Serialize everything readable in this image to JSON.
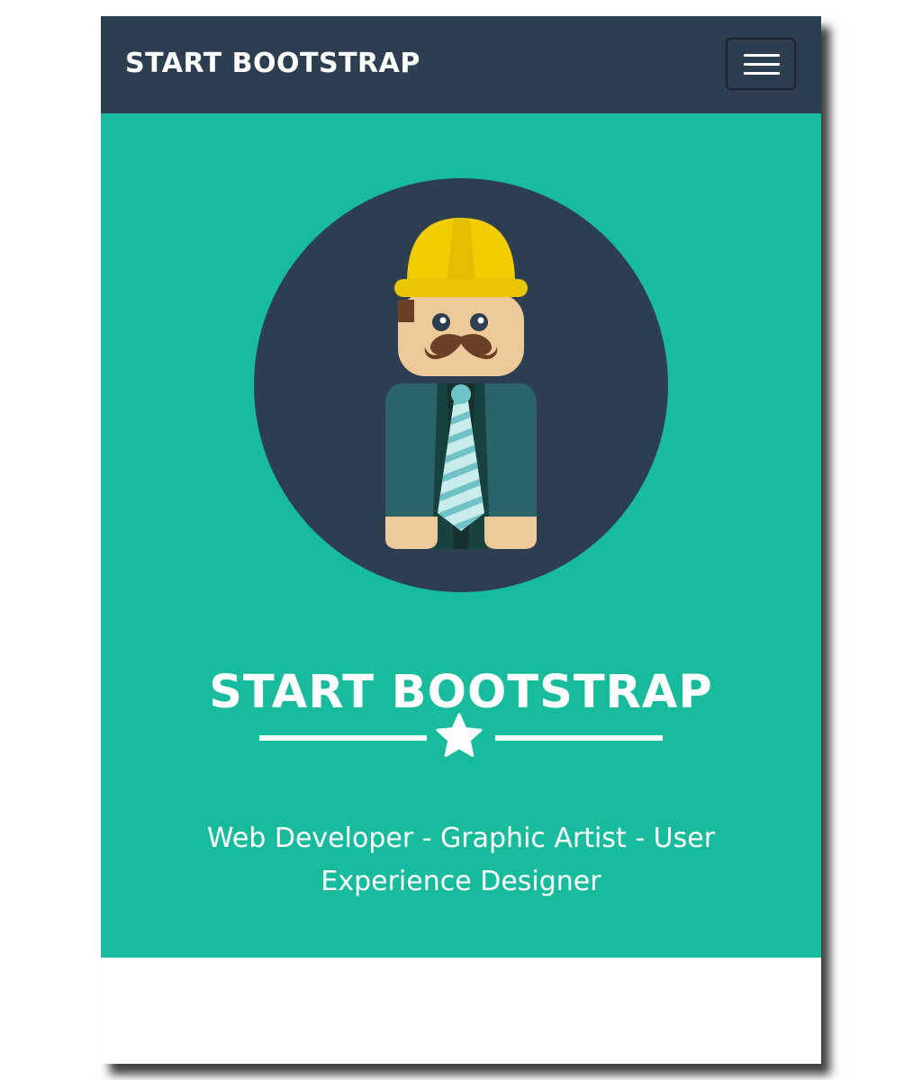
{
  "navbar": {
    "brand": "START BOOTSTRAP",
    "menu_icon": "hamburger-menu-icon"
  },
  "hero": {
    "avatar_icon": "construction-worker-avatar-icon",
    "title": "START BOOTSTRAP",
    "divider_icon": "star-icon",
    "tagline": "Web Developer - Graphic Artist - User Experience Designer"
  },
  "colors": {
    "navbar_bg": "#2c3e50",
    "hero_bg": "#18bc9c",
    "text": "#ffffff"
  }
}
